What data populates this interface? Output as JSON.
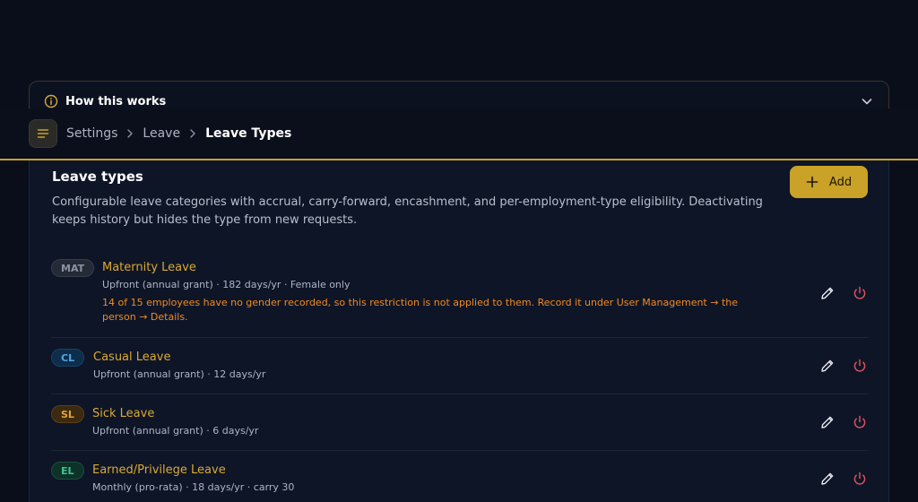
{
  "help": {
    "title": "How this works"
  },
  "breadcrumb": {
    "items": [
      "Settings",
      "Leave",
      "Leave Types"
    ]
  },
  "card": {
    "title": "Leave types",
    "description": "Configurable leave categories with accrual, carry-forward, encashment, and per-employment-type eligibility. Deactivating keeps history but hides the type from new requests.",
    "add_label": "Add"
  },
  "leave_types": [
    {
      "code": "MAT",
      "name": "Maternity Leave",
      "meta": "Upfront (annual grant) · 182 days/yr · Female only",
      "warning": "14 of 15 employees have no gender recorded, so this restriction is not applied to them. Record it under User Management → the person → Details."
    },
    {
      "code": "CL",
      "name": "Casual Leave",
      "meta": "Upfront (annual grant) · 12 days/yr"
    },
    {
      "code": "SL",
      "name": "Sick Leave",
      "meta": "Upfront (annual grant) · 6 days/yr"
    },
    {
      "code": "EL",
      "name": "Earned/Privilege Leave",
      "meta": "Monthly (pro-rata) · 18 days/yr · carry 30"
    }
  ],
  "colors": {
    "accent": "#c9a227",
    "name": "#d9a934",
    "warning": "#f08a24",
    "danger": "#e0555c"
  },
  "icons": {
    "help": "info-icon",
    "collapse": "chevron-down-icon",
    "menu": "menu-icon",
    "separator": "chevron-right-icon",
    "add": "plus-icon",
    "edit": "pencil-icon",
    "deactivate": "power-icon"
  }
}
